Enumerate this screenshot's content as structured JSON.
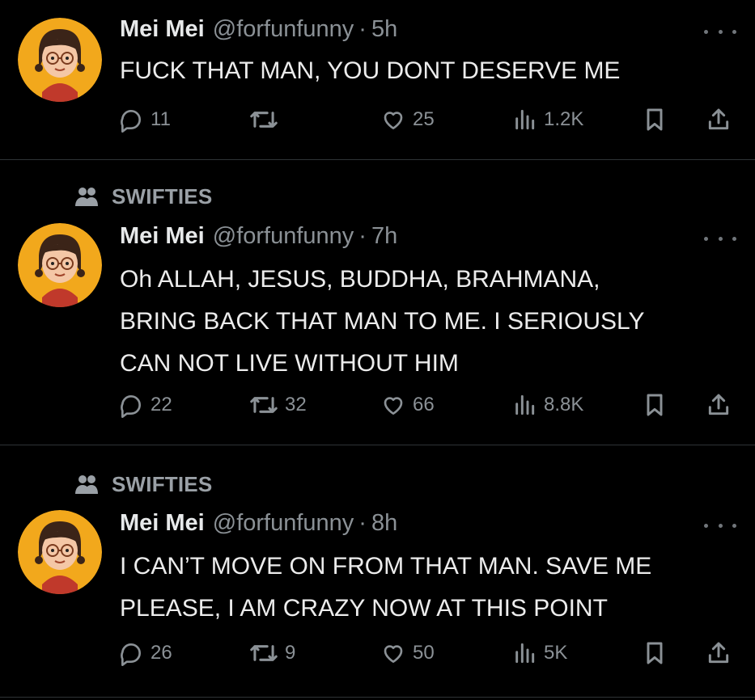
{
  "colors": {
    "background": "#000000",
    "text_primary": "#e7e9ea",
    "text_secondary": "#8b9196",
    "divider": "#2f3336",
    "avatar_bg": "#f2a81c"
  },
  "tweets": [
    {
      "community": "",
      "name": "Mei Mei",
      "handle": "@forfunfunny",
      "separator": "·",
      "time": "5h",
      "lines": [
        "FUCK THAT MAN, YOU DONT DESERVE ME"
      ],
      "replies": "11",
      "retweets": "",
      "likes": "25",
      "views": "1.2K"
    },
    {
      "community": "SWIFTIES",
      "name": "Mei Mei",
      "handle": "@forfunfunny",
      "separator": "·",
      "time": "7h",
      "lines": [
        "Oh ALLAH, JESUS, BUDDHA, BRAHMANA,",
        "BRING BACK THAT MAN TO ME. I SERIOUSLY",
        "CAN NOT LIVE WITHOUT HIM"
      ],
      "replies": "22",
      "retweets": "32",
      "likes": "66",
      "views": "8.8K"
    },
    {
      "community": "SWIFTIES",
      "name": "Mei Mei",
      "handle": "@forfunfunny",
      "separator": "·",
      "time": "8h",
      "lines": [
        "I CAN’T MOVE ON FROM THAT MAN. SAVE ME",
        "PLEASE, I AM CRAZY NOW AT THIS POINT"
      ],
      "replies": "26",
      "retweets": "9",
      "likes": "50",
      "views": "5K"
    }
  ],
  "icons": {
    "reply": "reply-icon",
    "retweet": "retweet-icon",
    "like": "heart-icon",
    "views": "views-icon",
    "bookmark": "bookmark-icon",
    "share": "share-icon",
    "more": "more-icon",
    "community": "community-icon"
  }
}
